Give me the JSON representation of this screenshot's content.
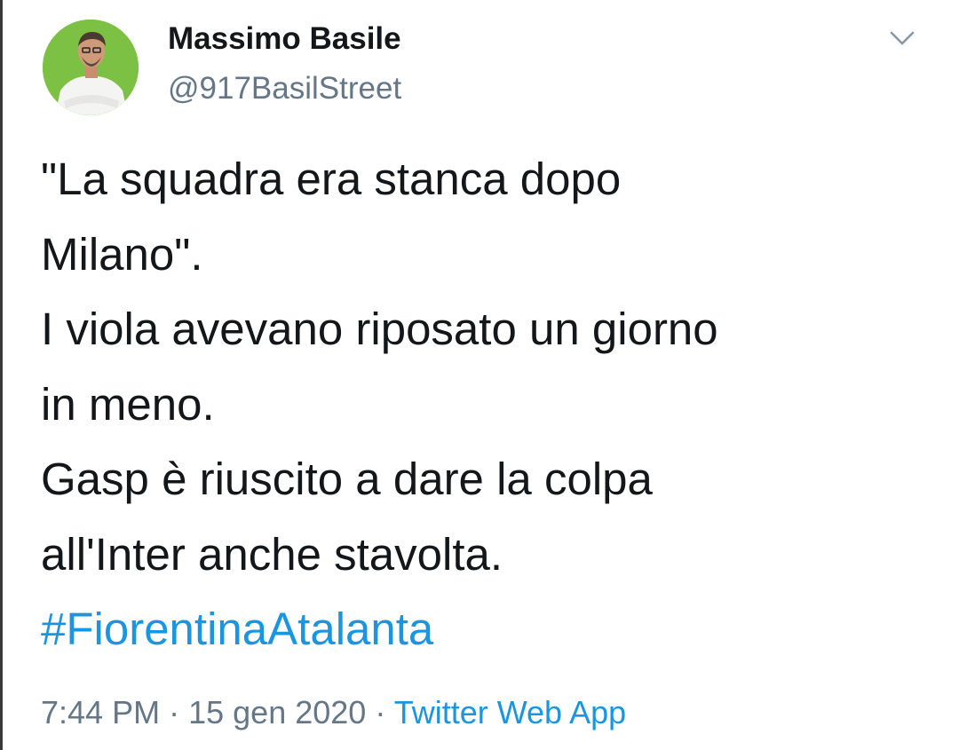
{
  "author": {
    "name": "Massimo Basile",
    "handle": "@917BasilStreet",
    "avatar": "profile-photo"
  },
  "menu_icon": "chevron-down-icon",
  "tweet": {
    "lines": [
      "\"La squadra era stanca dopo",
      "Milano\".",
      "I viola avevano riposato un giorno",
      "in meno.",
      "Gasp è riuscito a dare la colpa",
      "all'Inter anche stavolta."
    ],
    "hashtag": "#FiorentinaAtalanta"
  },
  "meta": {
    "time": "7:44 PM",
    "separator": "·",
    "date": "15 gen 2020",
    "source": "Twitter Web App"
  },
  "colors": {
    "text": "#14171a",
    "secondary": "#657786",
    "link": "#1b95e0",
    "avatar_bg": "#7cc044"
  }
}
